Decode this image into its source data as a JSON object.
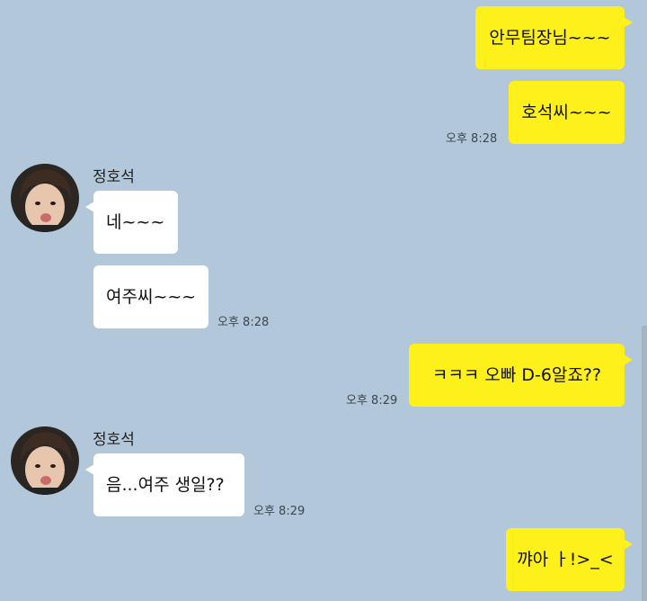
{
  "messages": [
    {
      "text": "안무팀장님~~~"
    },
    {
      "text": "호석씨~~~",
      "time": "오후 8:28"
    },
    {
      "text": "네~~~"
    },
    {
      "text": "여주씨~~~",
      "time": "오후 8:28"
    },
    {
      "text": "ㅋㅋㅋ 오빠 D-6알죠??",
      "time": "오후 8:29"
    },
    {
      "text": "음...여주 생일??",
      "time": "오후 8:29"
    },
    {
      "text": "꺄아 ㅏ!>_<"
    }
  ],
  "contacts": [
    {
      "name": "정호석"
    },
    {
      "name": "정호석"
    }
  ],
  "colors": {
    "background": "#b2c7d9",
    "my_bubble": "#fef01b",
    "their_bubble": "#ffffff"
  }
}
